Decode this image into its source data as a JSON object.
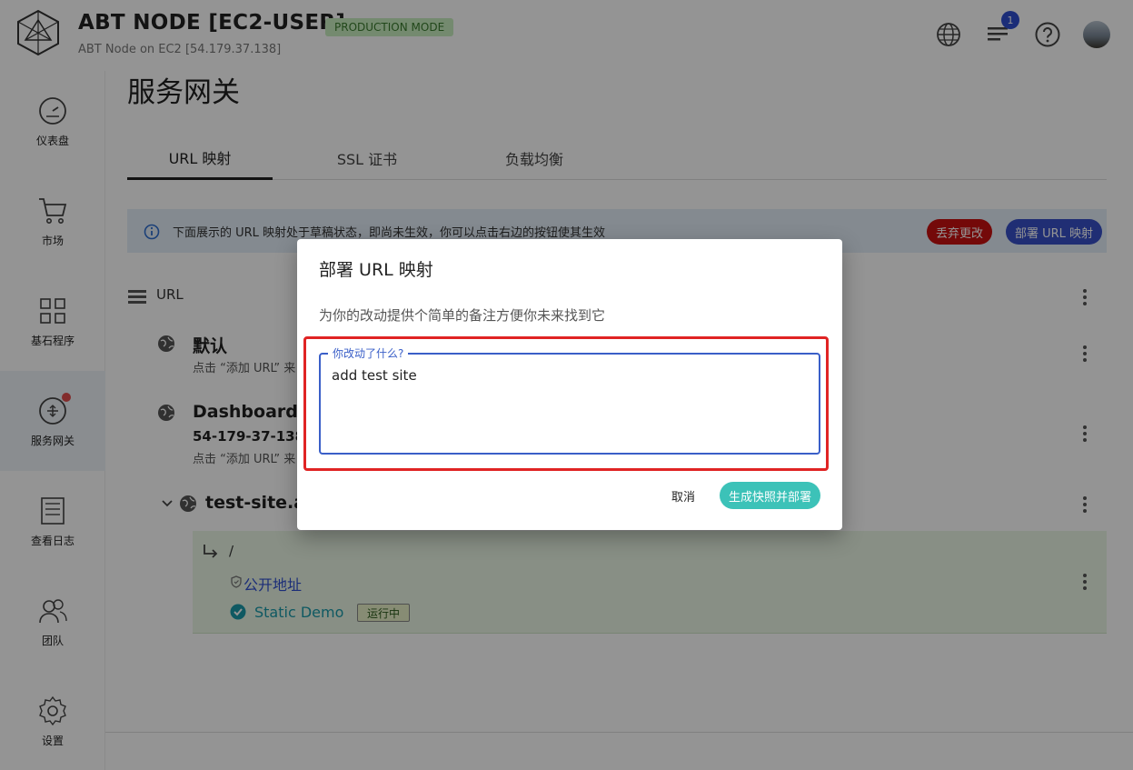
{
  "header": {
    "title": "ABT NODE [EC2-USER]",
    "mode_badge": "PRODUCTION MODE",
    "subtitle": "ABT Node on EC2 [54.179.37.138]",
    "notification_count": "1",
    "icons": [
      "globe-icon",
      "notifications-icon",
      "help-icon",
      "avatar"
    ]
  },
  "sidebar": {
    "items": [
      {
        "label": "仪表盘",
        "icon": "dashboard-icon"
      },
      {
        "label": "市场",
        "icon": "cart-icon"
      },
      {
        "label": "基石程序",
        "icon": "blocklets-icon"
      },
      {
        "label": "服务网关",
        "icon": "gateway-icon",
        "active": true
      },
      {
        "label": "查看日志",
        "icon": "logs-icon"
      },
      {
        "label": "团队",
        "icon": "team-icon"
      },
      {
        "label": "设置",
        "icon": "settings-icon"
      }
    ]
  },
  "main": {
    "page_title": "服务网关",
    "tabs": [
      {
        "label": "URL 映射",
        "active": true
      },
      {
        "label": "SSL 证书"
      },
      {
        "label": "负载均衡"
      }
    ],
    "info_bar": {
      "text": "下面展示的 URL 映射处于草稿状态，即尚未生效，你可以点击右边的按钮使其生效",
      "discard_label": "丢弃更改",
      "deploy_label": "部署 URL 映射"
    },
    "list_header": "URL",
    "sites": [
      {
        "title": "默认",
        "sub": "点击 “添加 URL” 来"
      },
      {
        "title": "Dashboard",
        "host": "54-179-37-138.",
        "sub": "点击 “添加 URL” 来"
      },
      {
        "title": "test-site.ar"
      }
    ],
    "rule": {
      "path": "/",
      "link": "公开地址",
      "app": "Static Demo",
      "status": "运行中"
    }
  },
  "dialog": {
    "title": "部署 URL 映射",
    "description": "为你的改动提供个简单的备注方便你未来找到它",
    "field_label": "你改动了什么?",
    "field_value": "add test site",
    "cancel_label": "取消",
    "confirm_label": "生成快照并部署"
  },
  "colors": {
    "accent": "#3750c8",
    "danger": "#c81010",
    "confirm": "#3cc2b8",
    "highlight": "#e02424"
  }
}
